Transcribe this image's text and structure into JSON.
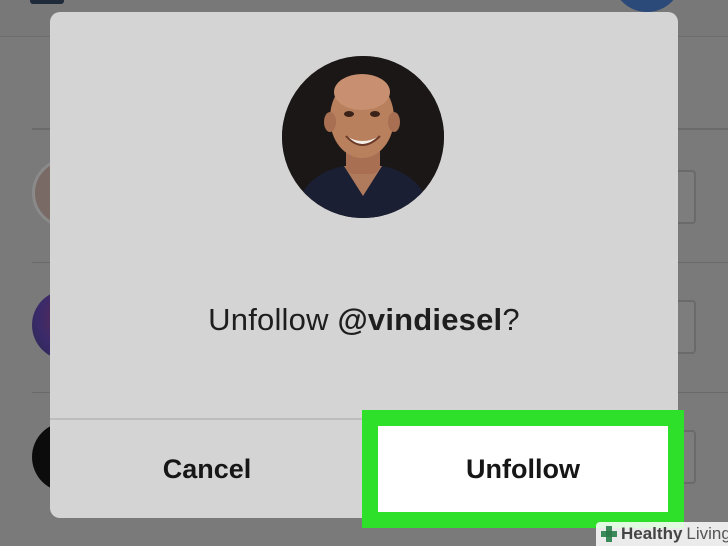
{
  "dialog": {
    "message_prefix": "Unfollow ",
    "handle": "@vindiesel",
    "message_suffix": "?",
    "cancel_label": "Cancel",
    "unfollow_label": "Unfollow"
  },
  "watermark": {
    "brand_bold": "Healthy",
    "brand_regular": "Living"
  },
  "colors": {
    "highlight": "#2ee02a",
    "dialog_bg": "#d4d4d4",
    "overlay": "#7a7a7a"
  }
}
